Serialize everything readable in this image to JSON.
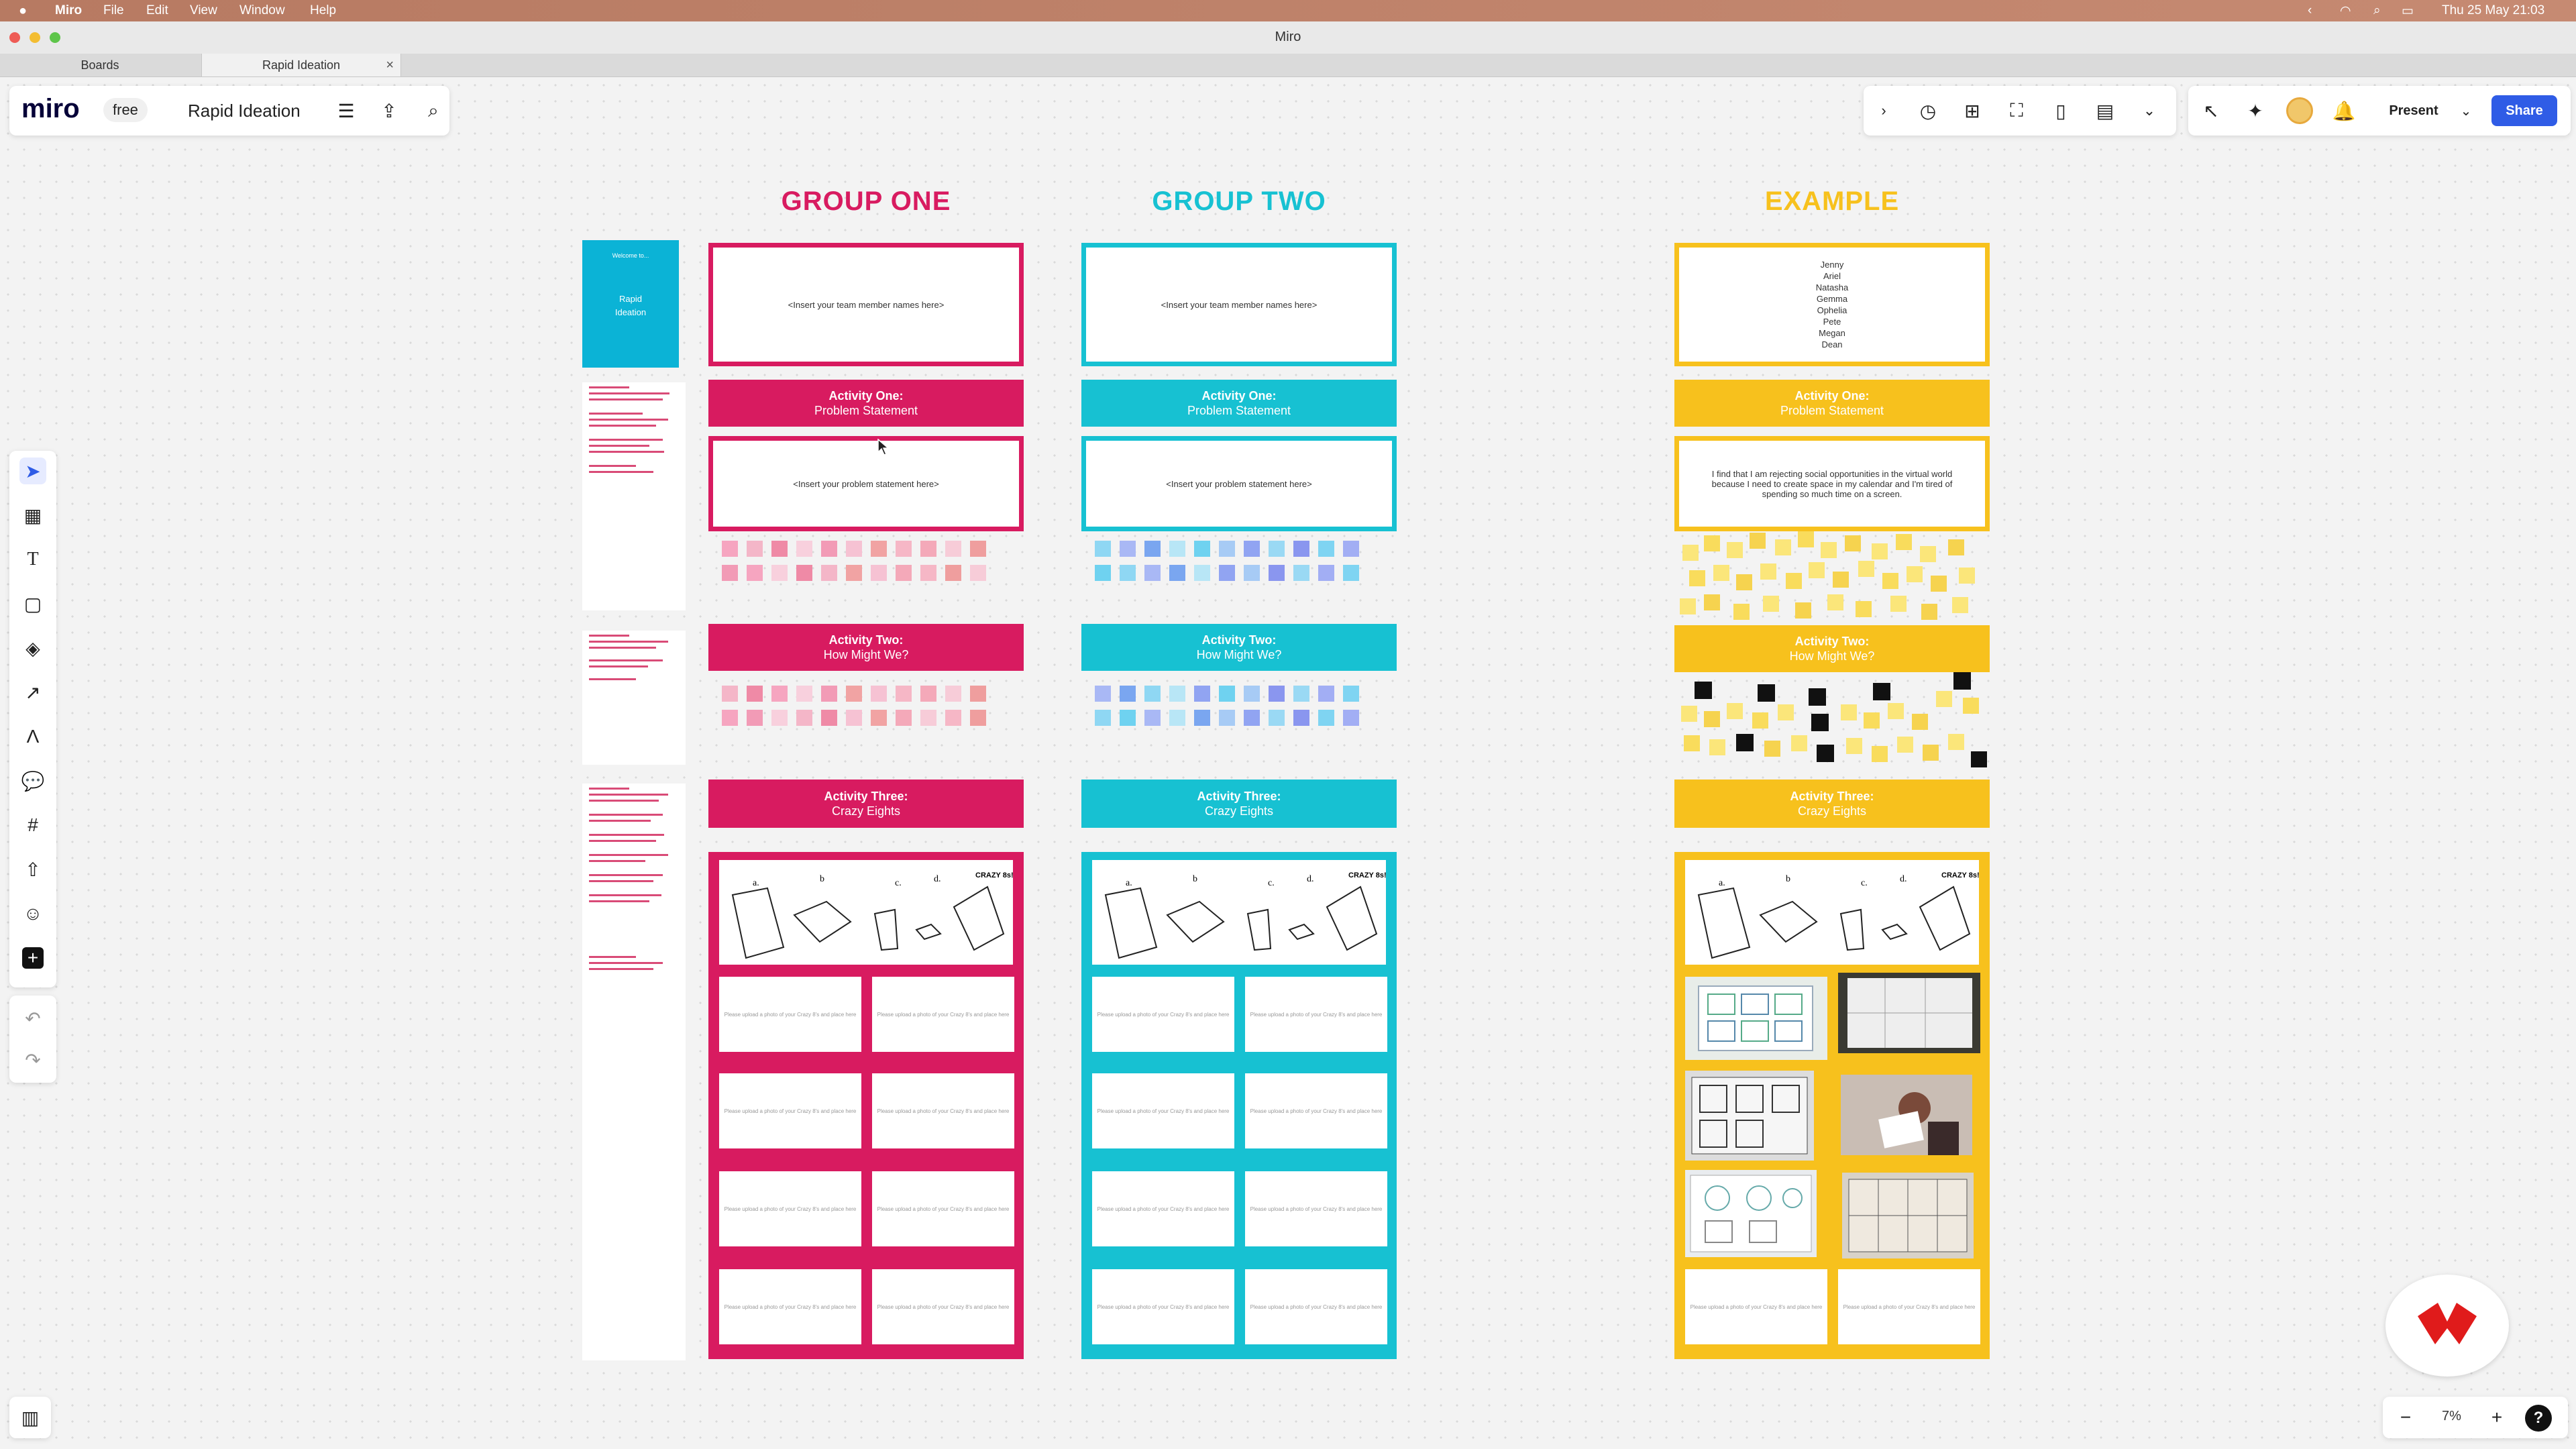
{
  "menubar": {
    "apple": "",
    "app": "Miro",
    "items": [
      "File",
      "Edit",
      "View",
      "Window",
      "Help"
    ],
    "datetime": "Thu 25 May  21:03"
  },
  "window": {
    "title": "Miro"
  },
  "tabs": [
    {
      "label": "Boards"
    },
    {
      "label": "Rapid Ideation"
    }
  ],
  "toolbar": {
    "logo": "miro",
    "plan": "free",
    "board_name": "Rapid Ideation",
    "present_label": "Present",
    "share_label": "Share"
  },
  "zoom": {
    "level": "7%",
    "minus": "−",
    "plus": "+",
    "help": "?"
  },
  "sidebar_card": {
    "welcome": "Welcome to...",
    "title": "Rapid Ideation"
  },
  "columns": {
    "one": {
      "title": "GROUP ONE",
      "names_placeholder": "<Insert your team member names here>",
      "activity1": {
        "heading": "Activity One:",
        "sub": "Problem Statement"
      },
      "problem_placeholder": "<Insert your problem statement here>",
      "activity2": {
        "heading": "Activity Two:",
        "sub": "How Might We?"
      },
      "activity3": {
        "heading": "Activity Three:",
        "sub": "Crazy Eights"
      }
    },
    "two": {
      "title": "GROUP TWO",
      "names_placeholder": "<Insert your team member names here>",
      "activity1": {
        "heading": "Activity One:",
        "sub": "Problem Statement"
      },
      "problem_placeholder": "<Insert your problem statement here>",
      "activity2": {
        "heading": "Activity Two:",
        "sub": "How Might We?"
      },
      "activity3": {
        "heading": "Activity Three:",
        "sub": "Crazy Eights"
      }
    },
    "example": {
      "title": "EXAMPLE",
      "names": "Jenny\nAriel\nNatasha\nGemma\nOphelia\nPete\nMegan\nDean",
      "activity1": {
        "heading": "Activity One:",
        "sub": "Problem Statement"
      },
      "problem": "I find that I am rejecting social opportunities in the virtual world because I need to create space in my calendar and I'm tired of spending so much time on a screen.",
      "activity2": {
        "heading": "Activity Two:",
        "sub": "How Might We?"
      },
      "activity3": {
        "heading": "Activity Three:",
        "sub": "Crazy Eights"
      }
    }
  },
  "cell_placeholder": "Please upload a photo of your Crazy 8's and place here",
  "sketch_letters": [
    "a.",
    "b",
    "c.",
    "d.",
    "CRAZY 8s!"
  ],
  "colors": {
    "pink": "#d81b60",
    "teal": "#17c1d2",
    "yellow": "#f7c11d",
    "share": "#2f5ce6"
  }
}
